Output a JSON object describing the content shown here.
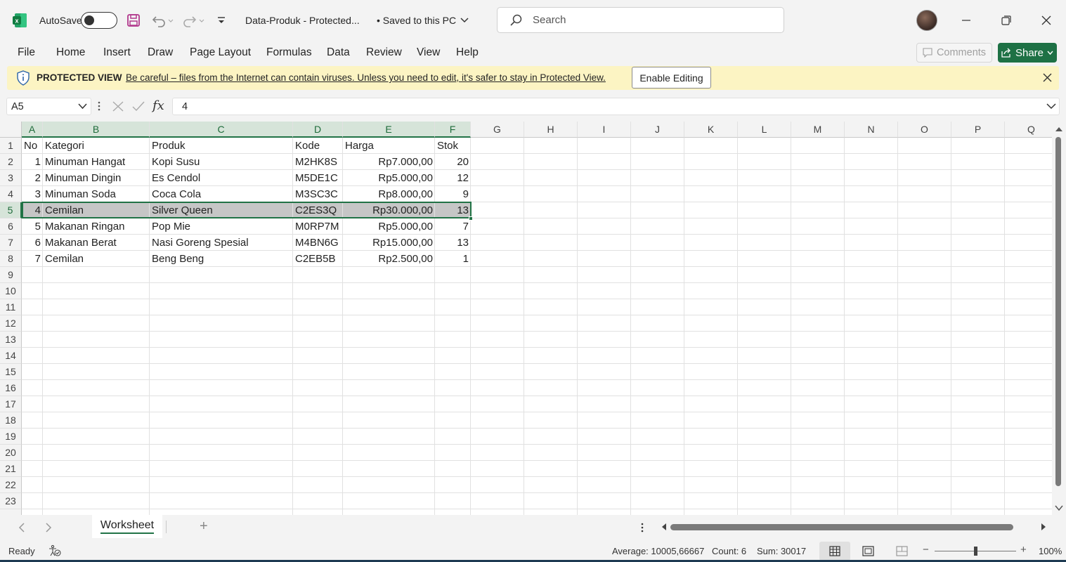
{
  "titlebar": {
    "autosave_label": "AutoSave",
    "file_name": "Data-Produk  -  Protected...",
    "save_status": "• Saved to this PC",
    "search_placeholder": "Search"
  },
  "menu": {
    "items": [
      "File",
      "Home",
      "Insert",
      "Draw",
      "Page Layout",
      "Formulas",
      "Data",
      "Review",
      "View",
      "Help"
    ],
    "comments_label": "Comments",
    "share_label": "Share"
  },
  "protected_view": {
    "title": "PROTECTED VIEW",
    "message": "Be careful – files from the Internet can contain viruses. Unless you need to edit, it's safer to stay in Protected View.",
    "enable_label": "Enable Editing"
  },
  "formula_bar": {
    "name_box": "A5",
    "fx_label": "fx",
    "value": "4"
  },
  "grid": {
    "columns": [
      "A",
      "B",
      "C",
      "D",
      "E",
      "F",
      "G",
      "H",
      "I",
      "J",
      "K",
      "L",
      "M",
      "N",
      "O",
      "P",
      "Q"
    ],
    "row_numbers": [
      "1",
      "2",
      "3",
      "4",
      "5",
      "6",
      "7",
      "8",
      "9",
      "10",
      "11",
      "12",
      "13",
      "14",
      "15",
      "16",
      "17",
      "18",
      "19",
      "20",
      "21",
      "22",
      "23"
    ],
    "selected_row": "5",
    "header": [
      "No",
      "Kategori",
      "Produk",
      "Kode",
      "Harga",
      "Stok"
    ],
    "rows": [
      [
        "1",
        "Minuman Hangat",
        "Kopi Susu",
        "M2HK8S",
        "Rp7.000,00",
        "20"
      ],
      [
        "2",
        "Minuman Dingin",
        "Es Cendol",
        "M5DE1C",
        "Rp5.000,00",
        "12"
      ],
      [
        "3",
        "Minuman Soda",
        "Coca Cola",
        "M3SC3C",
        "Rp8.000,00",
        "9"
      ],
      [
        "4",
        "Cemilan",
        "Silver Queen",
        "C2ES3Q",
        "Rp30.000,00",
        "13"
      ],
      [
        "5",
        "Makanan Ringan",
        "Pop Mie",
        "M0RP7M",
        "Rp5.000,00",
        "7"
      ],
      [
        "6",
        "Makanan Berat",
        "Nasi Goreng Spesial",
        "M4BN6G",
        "Rp15.000,00",
        "13"
      ],
      [
        "7",
        "Cemilan",
        "Beng Beng",
        "C2EB5B",
        "Rp2.500,00",
        "1"
      ]
    ]
  },
  "sheets": {
    "active": "Worksheet",
    "add_label": "+"
  },
  "status": {
    "ready": "Ready",
    "average": "Average: 10005,66667",
    "count": "Count: 6",
    "sum": "Sum: 30017",
    "zoom": "100%",
    "zoom_fraction": 0.5
  },
  "colors": {
    "excel_green": "#217346",
    "protected_bg": "#fcf4c3"
  }
}
